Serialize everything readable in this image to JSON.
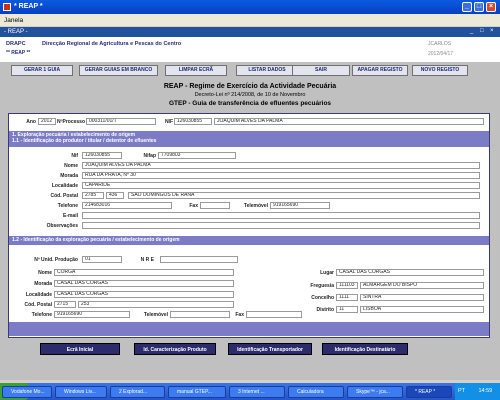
{
  "window": {
    "title": "* REAP *",
    "menu": "Janela"
  },
  "inner_title": "- REAP -",
  "header": {
    "org_code": "DRAPC",
    "org_name": "Direcção Regional de Agricultura e Pescas do Centro",
    "app_code": "** REAP **",
    "user": "JCARLOS",
    "date": "2012/04/17"
  },
  "toolbar": [
    "GERAR 1 GUIA",
    "GERAR GUIAS EM BRANCO",
    "LIMPAR ECRÃ",
    "LISTAR DADOS",
    "SAIR",
    "APAGAR REGISTO",
    "NOVO REGISTO"
  ],
  "title": {
    "line1": "REAP - Regime de Exercício da Actividade Pecuária",
    "line2": "Decreto-Lei nº 214/2008, de 10 de Novembro",
    "line3": "GTEP - Guia de transferência de efluentes pecuários"
  },
  "top": {
    "ano_label": "Ano",
    "ano": "2012",
    "processo_label": "NºProcesso",
    "processo": "000311/01/T",
    "nif_label": "NIF",
    "nif": "126030855",
    "nome": "JOAQUIM ALVES DA PALMA"
  },
  "section1": {
    "title": "1. Exploração pecuária / estabelecimento de origem",
    "subtitle": "1.1 - Identificação do produtor / titular / detentor de efluentes",
    "nif_label": "Nif",
    "nif": "126030855",
    "nifap_label": "Nifap",
    "nifap": "7709803",
    "nome_label": "Nome",
    "nome": "JOAQUIM ALVES DA PALMA",
    "morada_label": "Morada",
    "morada": "RUA DA PRATA, Nº 30",
    "localidade_label": "Localidade",
    "localidade": "CAPARIDE",
    "cp_label": "Cód. Postal",
    "cp1": "2785",
    "cp2": "436",
    "cp_local": "SÃO DOMINGOS DE RANA",
    "telefone_label": "Telefone",
    "telefone": "214683016",
    "fax_label": "Fax",
    "fax": "",
    "telemovel_label": "Telemóvel",
    "telemovel": "919165690",
    "email_label": "E-mail",
    "email": "",
    "obs_label": "Observações",
    "obs": ""
  },
  "section12": {
    "title": "1.2 - Identificação da exploração pecuária / estabelecimento de origem",
    "unid_label": "Nº Unid. Produção",
    "unid": "01",
    "nre_label": "N R E",
    "nre": "",
    "nome_label": "Nome",
    "nome": "CORGA",
    "morada_label": "Morada",
    "morada": "CASAL DAS CORGAS",
    "localidade_label": "Localidade",
    "localidade": "CASAL DAS CORGAS",
    "cp_label": "Cód. Postal",
    "cp1": "2715",
    "cp2": "253",
    "telefone_label": "Telefone",
    "telefone": "919165690",
    "telemovel_label": "Telemóvel",
    "telemovel": "",
    "fax_label": "Fax",
    "fax": "",
    "lugar_label": "Lugar",
    "lugar": "CASAL DAS CORGAS",
    "freguesia_label": "Freguesia",
    "freg_code": "111103",
    "freguesia": "ALMARGEM DO BISPO",
    "concelho_label": "Concelho",
    "conc_code": "1111",
    "concelho": "SINTRA",
    "distrito_label": "Distrito",
    "dist_code": "11",
    "distrito": "LISBOA"
  },
  "bottom_buttons": [
    "Ecrã Inicial",
    "Id. Caracterização Produto",
    "Identificação Transportador",
    "Identificação Destinatário"
  ],
  "taskbar": {
    "start": "start",
    "items": [
      "Vodafone Mo...",
      "Windows Liv...",
      "2 Explorad...",
      "manual GTEP...",
      "3 Internet ...",
      "Calculadora",
      "Skype™ - jca...",
      "* REAP *"
    ],
    "lang": "PT",
    "clock": "14:59"
  }
}
